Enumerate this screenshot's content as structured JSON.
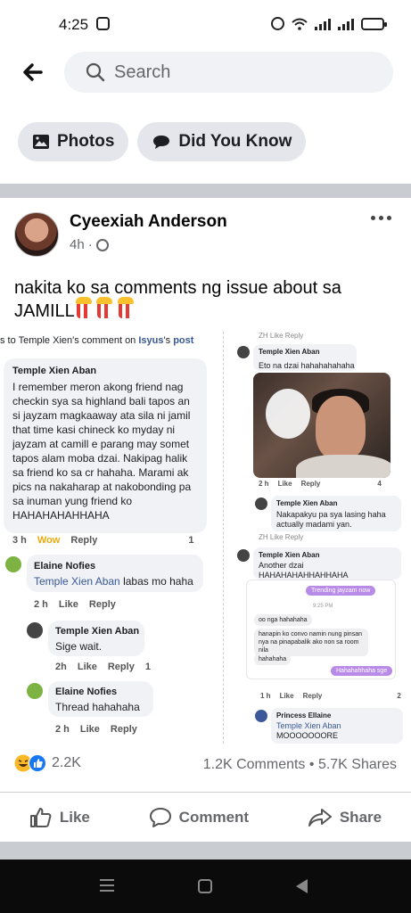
{
  "status_bar": {
    "time": "4:25"
  },
  "search": {
    "placeholder": "Search"
  },
  "chips": [
    {
      "label": "Photos",
      "icon": "photo-icon"
    },
    {
      "label": "Did You Know",
      "icon": "speech-bubble-icon"
    }
  ],
  "post": {
    "author": "Cyeexiah Anderson",
    "time": "4h",
    "privacy_icon": "globe-icon",
    "text_line1": "nakita ko sa comments ng issue about sa",
    "text_line2": "JAMILL",
    "reaction_count": "2.2K",
    "comments": "1.2K Comments",
    "shares": "5.7K Shares",
    "actions": {
      "like": "Like",
      "comment": "Comment",
      "share": "Share"
    }
  },
  "shot": {
    "header": {
      "prefix": "s to Temple Xien's comment on",
      "page": "Isyus",
      "suffix": "'s",
      "post": "post"
    },
    "left": {
      "c1_name": "Temple Xien Aban",
      "c1_lines": [
        "I remember meron akong friend nag",
        "checkin sya sa highland bali tapos an",
        "si jayzam magkaaway ata sila ni jamil",
        "that time kasi chineck ko myday ni",
        "jayzam at camill e parang may somet",
        "tapos alam moba dzai. Nakipag halik",
        "sa friend ko sa cr hahaha. Marami ak",
        "pics na nakaharap at nakobonding pa",
        "sa inuman yung friend ko",
        "HAHAHAHAHHAHA"
      ],
      "c1_time": "3 h",
      "c1_reaction": "Wow",
      "c1_reply": "Reply",
      "c1_count": "1",
      "c2_name": "Elaine Nofies",
      "c2_mention": "Temple Xien Aban",
      "c2_text": " labas mo haha",
      "c2_time": "2 h",
      "c3_name": "Temple Xien Aban",
      "c3_text": "Sige wait.",
      "c3_time": "2h",
      "c3_count": "1",
      "c4_name": "Elaine Nofies",
      "c4_text": "Thread hahahaha",
      "c4_time": "2 h",
      "like": "Like",
      "reply": "Reply"
    },
    "right": {
      "top_actions": "ZH   Like   Reply",
      "r1_name": "Temple Xien Aban",
      "r1_text": "Eto na dzai hahahahahaha",
      "r1_time": "2 h",
      "r1_count": "4",
      "r2_name": "Temple Xien Aban",
      "r2_lines": [
        "Nakapakyu pa sya lasing haha",
        "actually madami yan."
      ],
      "mid_actions": "ZH   Like   Reply",
      "r3_name": "Temple Xien Aban",
      "r3_lines": [
        "Another dzai",
        "HAHAHAHAHHAHHAHA"
      ],
      "msg_pill1": "Trending jayzam now",
      "msg_time": "9:25 PM",
      "msg_1": "oo nga hahahaha",
      "msg_2": "hanapin ko convo namin nung pinsan nya na pinapabalik ako non sa room nila",
      "msg_3": "hahahaha",
      "msg_pill2": "Hahahahhaha sge",
      "r3_time": "1 h",
      "r3_count": "2",
      "r4_name": "Princess Ellaine",
      "r4_mention": "Temple Xien Aban",
      "r4_text": "MOOOOOOORE",
      "like": "Like",
      "reply": "Reply"
    }
  },
  "colors": {
    "brand": "#1877f2",
    "text": "#050505",
    "muted": "#65676b",
    "background_band": "#c9ccd1"
  }
}
